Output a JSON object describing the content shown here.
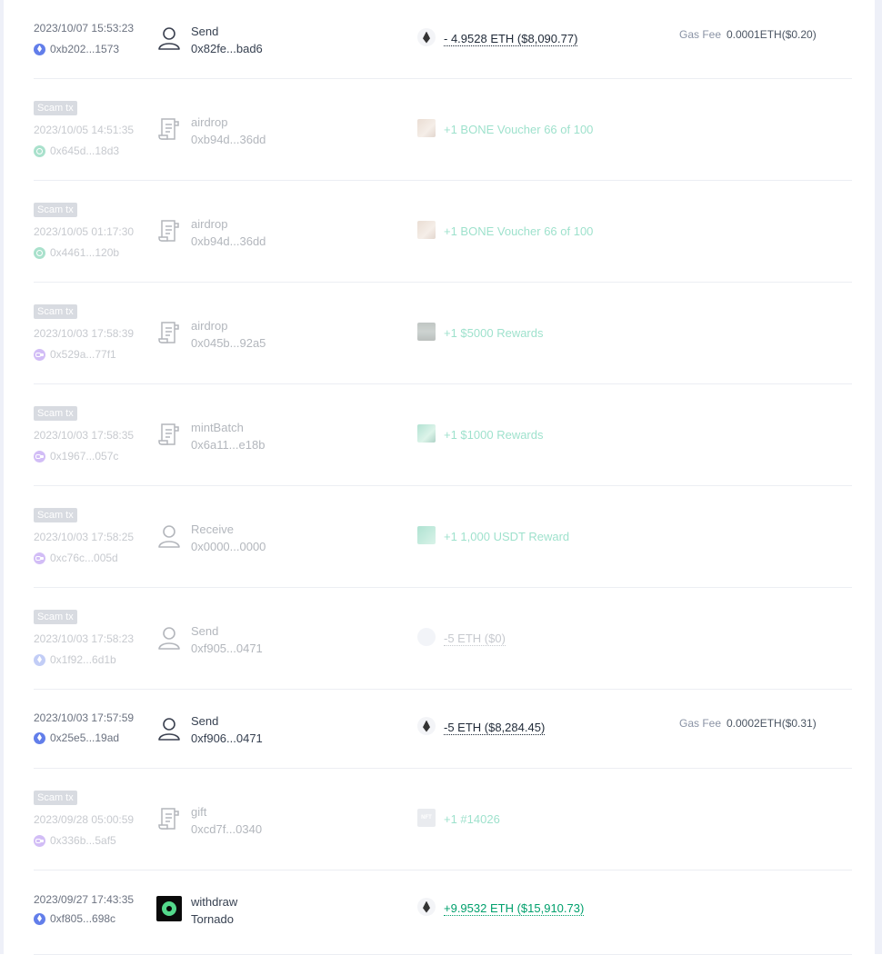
{
  "transactions": [
    {
      "scam": false,
      "badge": "",
      "time": "2023/10/07 15:53:23",
      "chain": "eth",
      "hash": "0xb202...1573",
      "icon": "person-icon",
      "method": "Send",
      "counterparty": "0x82fe...bad6",
      "token_icon": "eth-icon",
      "amount": "- 4.9528 ETH ($8,090.77)",
      "amount_style": "neg",
      "gas_label": "Gas Fee",
      "gas_value": "0.0001ETH($0.20)"
    },
    {
      "scam": true,
      "badge": "Scam tx",
      "time": "2023/10/05 14:51:35",
      "chain": "green",
      "hash": "0x645d...18d3",
      "icon": "contract-icon",
      "method": "airdrop",
      "counterparty": "0xb94d...36dd",
      "token_icon": "bone-voucher-icon",
      "amount": "+1 BONE Voucher 66 of 100",
      "amount_style": "pos",
      "gas_label": "",
      "gas_value": ""
    },
    {
      "scam": true,
      "badge": "Scam tx",
      "time": "2023/10/05 01:17:30",
      "chain": "green",
      "hash": "0x4461...120b",
      "icon": "contract-icon",
      "method": "airdrop",
      "counterparty": "0xb94d...36dd",
      "token_icon": "bone-voucher-icon",
      "amount": "+1 BONE Voucher 66 of 100",
      "amount_style": "pos",
      "gas_label": "",
      "gas_value": ""
    },
    {
      "scam": true,
      "badge": "Scam tx",
      "time": "2023/10/03 17:58:39",
      "chain": "purple",
      "hash": "0x529a...77f1",
      "icon": "contract-icon",
      "method": "airdrop",
      "counterparty": "0x045b...92a5",
      "token_icon": "reward-5000-icon",
      "amount": "+1 $5000 Rewards",
      "amount_style": "pos",
      "gas_label": "",
      "gas_value": ""
    },
    {
      "scam": true,
      "badge": "Scam tx",
      "time": "2023/10/03 17:58:35",
      "chain": "purple",
      "hash": "0x1967...057c",
      "icon": "contract-icon",
      "method": "mintBatch",
      "counterparty": "0x6a11...e18b",
      "token_icon": "reward-1000-icon",
      "amount": "+1 $1000 Rewards",
      "amount_style": "pos",
      "gas_label": "",
      "gas_value": ""
    },
    {
      "scam": true,
      "badge": "Scam tx",
      "time": "2023/10/03 17:58:25",
      "chain": "purple",
      "hash": "0xc76c...005d",
      "icon": "person-icon",
      "method": "Receive",
      "counterparty": "0x0000...0000",
      "token_icon": "usdt-reward-icon",
      "amount": "+1 1,000 USDT Reward",
      "amount_style": "pos",
      "gas_label": "",
      "gas_value": ""
    },
    {
      "scam": true,
      "badge": "Scam tx",
      "time": "2023/10/03 17:58:23",
      "chain": "eth",
      "hash": "0x1f92...6d1b",
      "icon": "person-icon",
      "method": "Send",
      "counterparty": "0xf905...0471",
      "token_icon": "unknown-token-icon",
      "amount": "-5 ETH ($0)",
      "amount_style": "neg-gray",
      "gas_label": "",
      "gas_value": ""
    },
    {
      "scam": false,
      "badge": "",
      "time": "2023/10/03 17:57:59",
      "chain": "eth",
      "hash": "0x25e5...19ad",
      "icon": "person-icon",
      "method": "Send",
      "counterparty": "0xf906...0471",
      "token_icon": "eth-icon",
      "amount": "-5 ETH ($8,284.45)",
      "amount_style": "neg",
      "gas_label": "Gas Fee",
      "gas_value": "0.0002ETH($0.31)"
    },
    {
      "scam": true,
      "badge": "Scam tx",
      "time": "2023/09/28 05:00:59",
      "chain": "purple",
      "hash": "0x336b...5af5",
      "icon": "contract-icon",
      "method": "gift",
      "counterparty": "0xcd7f...0340",
      "token_icon": "nft-icon",
      "amount": "+1 #14026",
      "amount_style": "pos",
      "gas_label": "",
      "gas_value": ""
    },
    {
      "scam": false,
      "badge": "",
      "time": "2023/09/27 17:43:35",
      "chain": "eth",
      "hash": "0xf805...698c",
      "icon": "tornado-icon",
      "method": "withdraw",
      "counterparty": "Tornado",
      "token_icon": "eth-icon",
      "amount": "+9.9532 ETH ($15,910.73)",
      "amount_style": "pos-u",
      "gas_label": "",
      "gas_value": ""
    }
  ],
  "nft_icon_text": "NFT"
}
